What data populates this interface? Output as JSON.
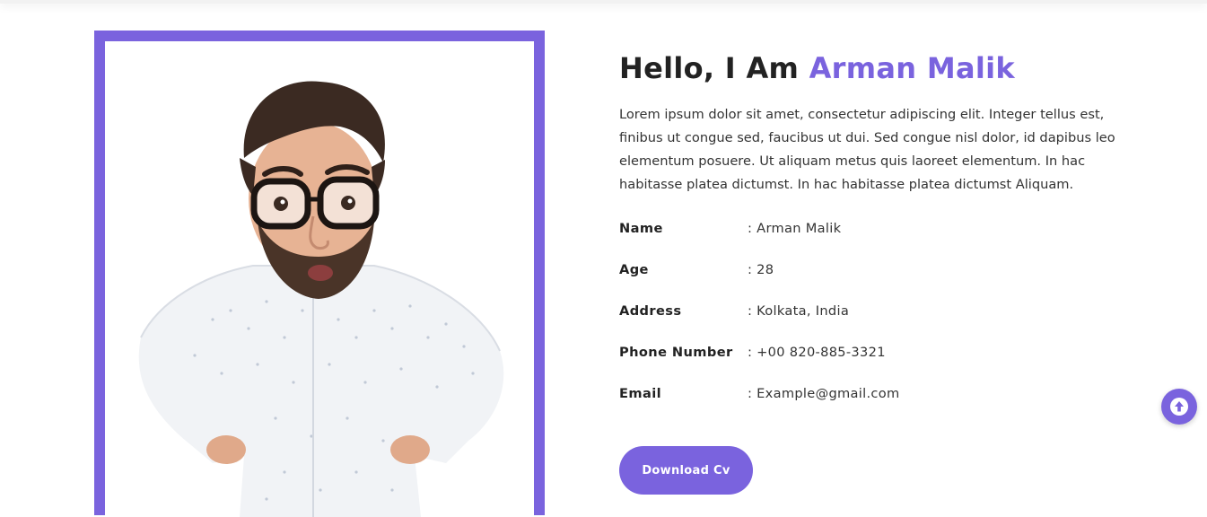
{
  "hero": {
    "greeting": "Hello, I Am ",
    "name": "Arman Malik",
    "bio": "Lorem ipsum dolor sit amet, consectetur adipiscing elit. Integer tellus est, finibus ut congue sed, faucibus ut dui. Sed congue nisl dolor, id dapibus leo elementum posuere. Ut aliquam metus quis laoreet elementum. In hac habitasse platea dictumst. In hac habitasse platea dictumst Aliquam."
  },
  "info": [
    {
      "label": "Name",
      "value": ": Arman Malik"
    },
    {
      "label": "Age",
      "value": ": 28"
    },
    {
      "label": "Address",
      "value": ": Kolkata, India"
    },
    {
      "label": "Phone Number",
      "value": ": +00 820-885-3321"
    },
    {
      "label": "Email",
      "value": ": Example@gmail.com"
    }
  ],
  "button": {
    "download_label": "Download Cv"
  },
  "icons": {
    "scroll_top": "arrow-up-circle-icon",
    "photo": "profile-photo"
  },
  "colors": {
    "accent": "#7a63de",
    "text": "#222222"
  }
}
